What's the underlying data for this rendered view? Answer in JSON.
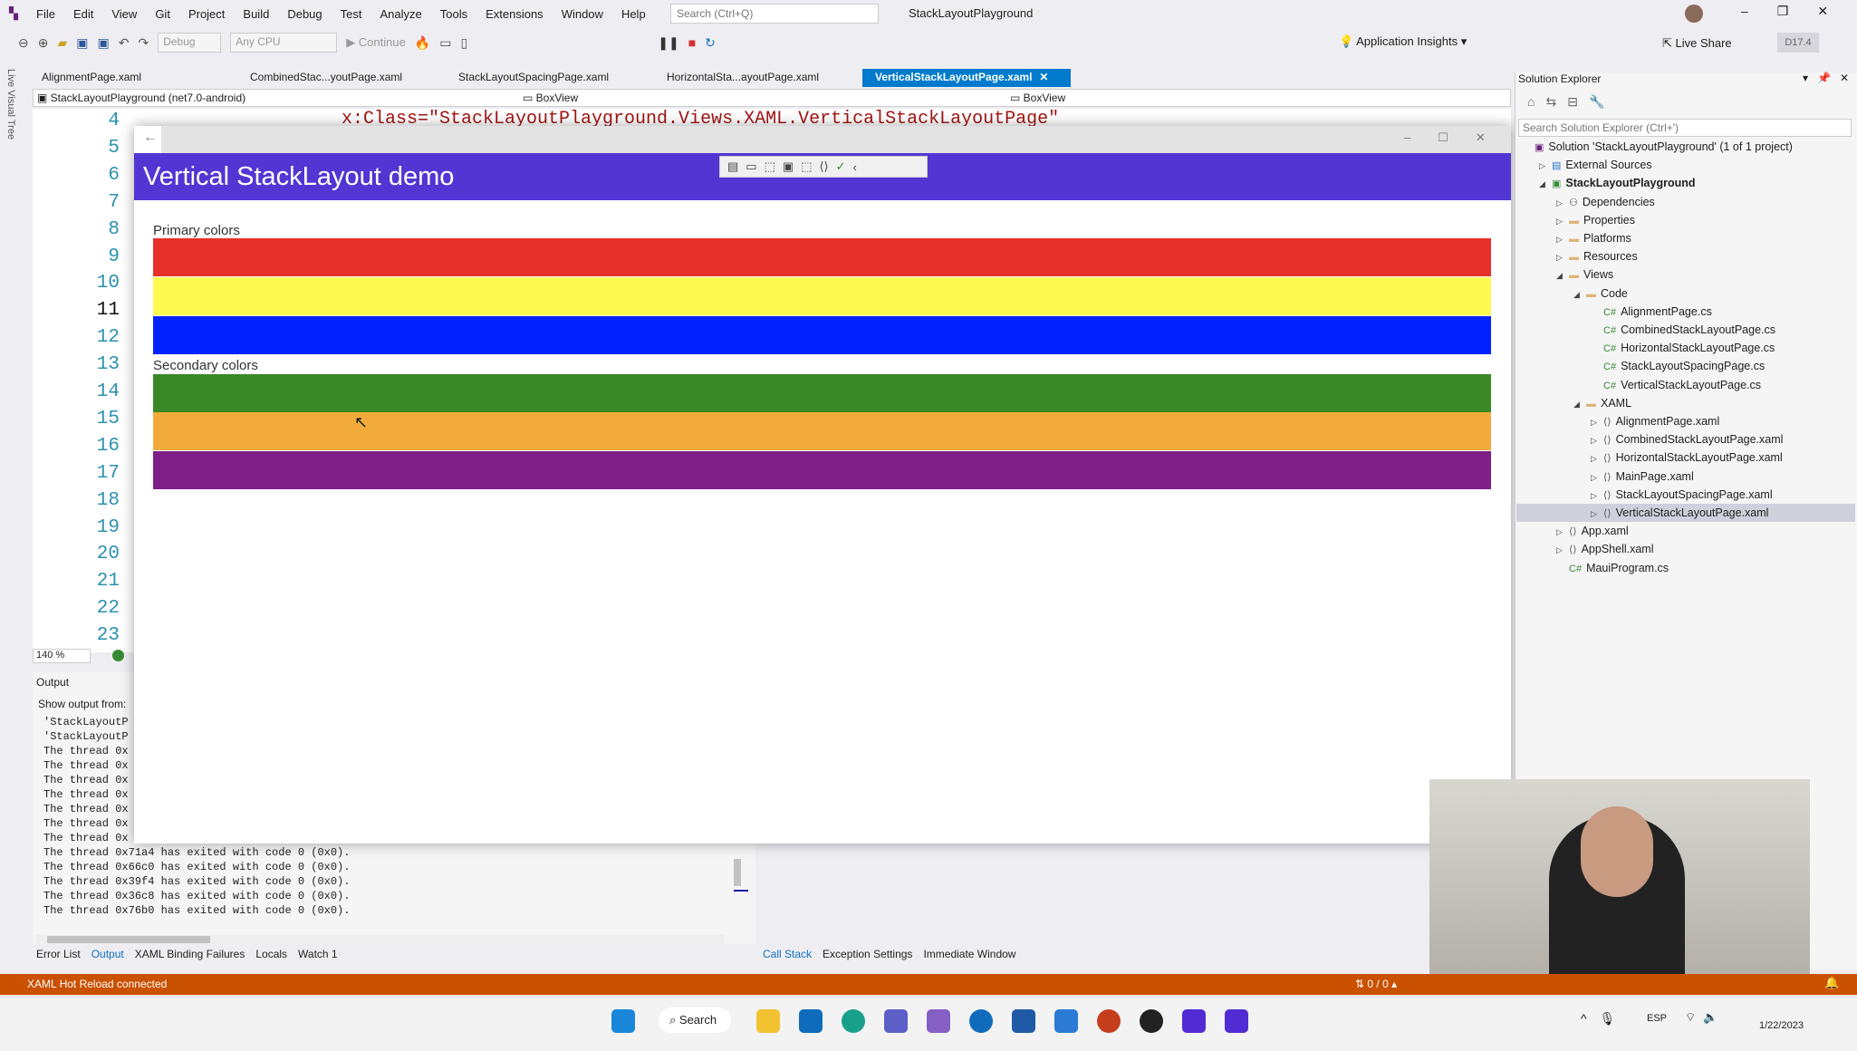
{
  "menu": {
    "items": [
      "File",
      "Edit",
      "View",
      "Git",
      "Project",
      "Build",
      "Debug",
      "Test",
      "Analyze",
      "Tools",
      "Extensions",
      "Window",
      "Help"
    ],
    "search_placeholder": "Search (Ctrl+Q)",
    "window_title": "StackLayoutPlayground"
  },
  "toolbar": {
    "config": "Debug",
    "platform": "Any CPU",
    "continue": "Continue",
    "app_insights": "Application Insights",
    "live_share": "Live Share",
    "version": "D17.4"
  },
  "side_tab": "Live Visual Tree",
  "tabs": [
    "AlignmentPage.xaml",
    "CombinedStac...youtPage.xaml",
    "StackLayoutSpacingPage.xaml",
    "HorizontalSta...ayoutPage.xaml",
    "VerticalStackLayoutPage.xaml"
  ],
  "navbar": {
    "project": "StackLayoutPlayground (net7.0-android)",
    "member1": "BoxView",
    "member2": "BoxView"
  },
  "editor": {
    "line_numbers": [
      "4",
      "5",
      "6",
      "7",
      "8",
      "9",
      "10",
      "11",
      "12",
      "13",
      "14",
      "15",
      "16",
      "17",
      "18",
      "19",
      "20",
      "21",
      "22",
      "23"
    ],
    "visible_code": "x:Class=\"StackLayoutPlayground.Views.XAML.VerticalStackLayoutPage\"",
    "zoom": "140 %"
  },
  "output": {
    "title": "Output",
    "show_from": "Show output from:",
    "lines": [
      "'StackLayoutP",
      "'StackLayoutP",
      "The thread 0x",
      "The thread 0x",
      "The thread 0x",
      "The thread 0x",
      "The thread 0x",
      "The thread 0x",
      "The thread 0x",
      "The thread 0x71a4 has exited with code 0 (0x0).",
      "The thread 0x66c0 has exited with code 0 (0x0).",
      "The thread 0x39f4 has exited with code 0 (0x0).",
      "The thread 0x36c8 has exited with code 0 (0x0).",
      "The thread 0x76b0 has exited with code 0 (0x0)."
    ]
  },
  "bottom_tabs_left": [
    "Error List",
    "Output",
    "XAML Binding Failures",
    "Locals",
    "Watch 1"
  ],
  "bottom_tabs_right": [
    "Call Stack",
    "Exception Settings",
    "Immediate Window"
  ],
  "status": {
    "text": "XAML Hot Reload connected",
    "git": "⇅ 0 / 0 ▴"
  },
  "app": {
    "header": "Vertical StackLayout demo",
    "primary_label": "Primary colors",
    "secondary_label": "Secondary colors",
    "primary_colors": [
      "#e8302a",
      "#fdfb52",
      "#0223ff"
    ],
    "secondary_colors": [
      "#3a8727",
      "#f2ab3a",
      "#7f1f87"
    ],
    "header_color": "#5136d3"
  },
  "solution_explorer": {
    "title": "Solution Explorer",
    "search_placeholder": "Search Solution Explorer (Ctrl+')",
    "items": [
      {
        "label": "Solution 'StackLayoutPlayground' (1 of 1 project)",
        "indent": 0,
        "icon": "solution"
      },
      {
        "label": "External Sources",
        "indent": 1,
        "icon": "external",
        "arrow": "▷"
      },
      {
        "label": "StackLayoutPlayground",
        "indent": 1,
        "icon": "csproj",
        "arrow": "◢",
        "bold": true
      },
      {
        "label": "Dependencies",
        "indent": 2,
        "icon": "deps",
        "arrow": "▷"
      },
      {
        "label": "Properties",
        "indent": 2,
        "icon": "folder",
        "arrow": "▷"
      },
      {
        "label": "Platforms",
        "indent": 2,
        "icon": "folder",
        "arrow": "▷"
      },
      {
        "label": "Resources",
        "indent": 2,
        "icon": "folder",
        "arrow": "▷"
      },
      {
        "label": "Views",
        "indent": 2,
        "icon": "folder",
        "arrow": "◢"
      },
      {
        "label": "Code",
        "indent": 3,
        "icon": "folder",
        "arrow": "◢"
      },
      {
        "label": "AlignmentPage.cs",
        "indent": 4,
        "icon": "cs"
      },
      {
        "label": "CombinedStackLayoutPage.cs",
        "indent": 4,
        "icon": "cs"
      },
      {
        "label": "HorizontalStackLayoutPage.cs",
        "indent": 4,
        "icon": "cs"
      },
      {
        "label": "StackLayoutSpacingPage.cs",
        "indent": 4,
        "icon": "cs"
      },
      {
        "label": "VerticalStackLayoutPage.cs",
        "indent": 4,
        "icon": "cs"
      },
      {
        "label": "XAML",
        "indent": 3,
        "icon": "folder",
        "arrow": "◢"
      },
      {
        "label": "AlignmentPage.xaml",
        "indent": 4,
        "icon": "xaml",
        "arrow": "▷"
      },
      {
        "label": "CombinedStackLayoutPage.xaml",
        "indent": 4,
        "icon": "xaml",
        "arrow": "▷"
      },
      {
        "label": "HorizontalStackLayoutPage.xaml",
        "indent": 4,
        "icon": "xaml",
        "arrow": "▷"
      },
      {
        "label": "MainPage.xaml",
        "indent": 4,
        "icon": "xaml",
        "arrow": "▷"
      },
      {
        "label": "StackLayoutSpacingPage.xaml",
        "indent": 4,
        "icon": "xaml",
        "arrow": "▷"
      },
      {
        "label": "VerticalStackLayoutPage.xaml",
        "indent": 4,
        "icon": "xaml",
        "arrow": "▷",
        "selected": true
      },
      {
        "label": "App.xaml",
        "indent": 2,
        "icon": "xaml",
        "arrow": "▷"
      },
      {
        "label": "AppShell.xaml",
        "indent": 2,
        "icon": "xaml",
        "arrow": "▷"
      },
      {
        "label": "MauiProgram.cs",
        "indent": 2,
        "icon": "cs"
      }
    ]
  },
  "taskbar": {
    "search": "Search",
    "lang": "ESP",
    "date": "1/22/2023"
  }
}
